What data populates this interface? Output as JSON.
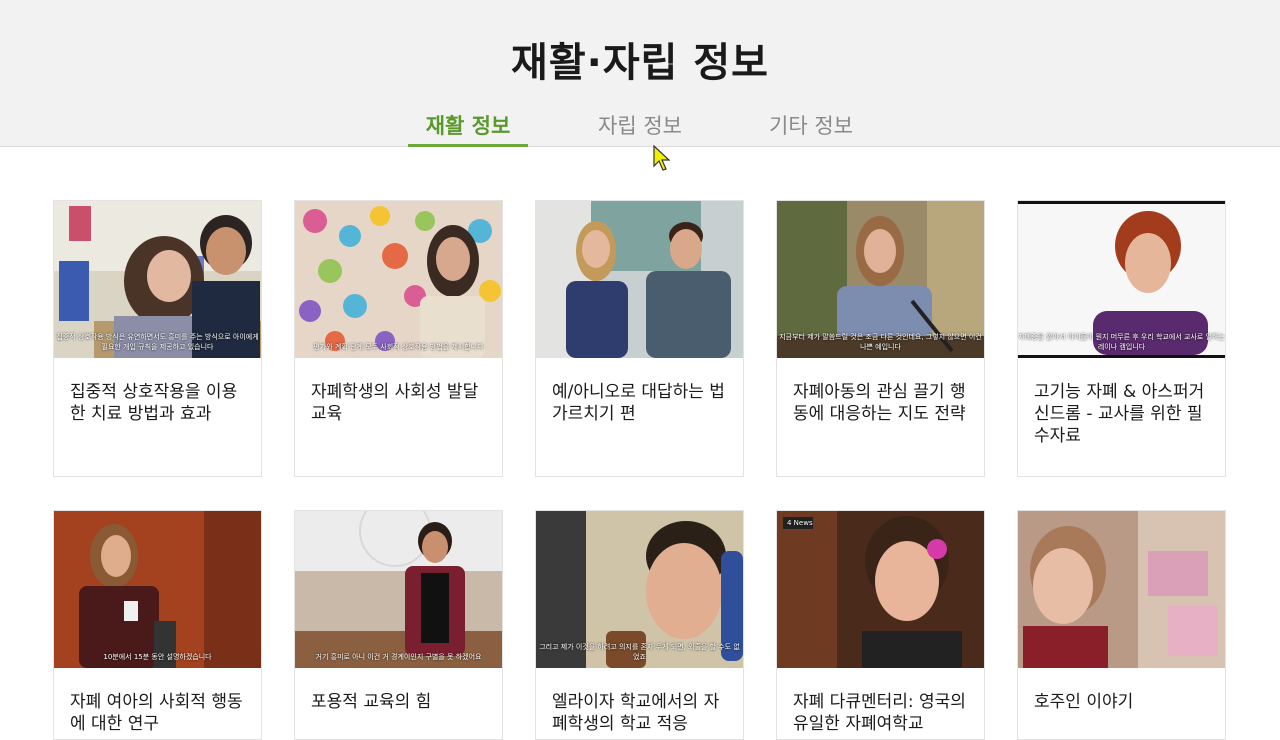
{
  "page": {
    "title": "재활·자립 정보"
  },
  "tabs": [
    {
      "label": "재활 정보",
      "active": true
    },
    {
      "label": "자립 정보",
      "active": false
    },
    {
      "label": "기타 정보",
      "active": false
    }
  ],
  "colors": {
    "accent": "#6aa83a",
    "header_bg": "#f2f2f2"
  },
  "cards": [
    {
      "title": "집중적 상호작용을 이용한 치료 방법과 효과",
      "caption": "집중적 상호작용 방식은 유연하면서도 흥미를 주는 방식으로 아이에게 필요한 개입 규칙을 제공하고 있습니다"
    },
    {
      "title": "자폐학생의 사회성 발달 교육",
      "caption": "평가와 계획 단계 모두 사회적 상호작용 방법을 제시합니다"
    },
    {
      "title": "예/아니오로 대답하는 법 가르치기 편",
      "caption": ""
    },
    {
      "title": "자폐아동의 관심 끌기 행동에 대응하는 지도 전략",
      "caption": "지금부터 제가 말씀드릴 것은 조금 다른 것인데요, 그렇지 않으면 이건 나쁜 예입니다"
    },
    {
      "title": "고기능 자폐 & 아스퍼거 신드롬 - 교사를 위한 필수자료",
      "caption": "자폐증을 앓아서 아이들이 뭔지 머무른 후 우리 학교에서 교사로 일하는 레이나 캠입니다"
    },
    {
      "title": "자폐 여아의 사회적 행동에 대한 연구",
      "caption": "10분에서 15분 동안 설명하겠습니다"
    },
    {
      "title": "포용적 교육의 힘",
      "caption": "거기 흥미로 아니 이건 거 경계이인지 구별을 못 하겠어요"
    },
    {
      "title": "엘라이자 학교에서의 자폐학생의 학교 적응",
      "caption": "그리고 제가 이것을 하려고 의지를 혼자 두게 되면, 외출을 할 수도 없었죠"
    },
    {
      "title": "자폐 다큐멘터리: 영국의 유일한 자폐여학교",
      "caption": ""
    },
    {
      "title": "호주인 이야기",
      "caption": ""
    }
  ],
  "thumbs": [
    {
      "name": "classroom-therapy-thumbnail"
    },
    {
      "name": "handprint-wall-thumbnail"
    },
    {
      "name": "two-presenters-thumbnail"
    },
    {
      "name": "woman-speaking-thumbnail"
    },
    {
      "name": "woman-interview-thumbnail"
    },
    {
      "name": "woman-presenting-thumbnail"
    },
    {
      "name": "lecturer-stage-thumbnail"
    },
    {
      "name": "student-smiling-thumbnail"
    },
    {
      "name": "girl-documentary-thumbnail"
    },
    {
      "name": "child-toys-thumbnail"
    }
  ],
  "badges": {
    "news": "4 News"
  }
}
